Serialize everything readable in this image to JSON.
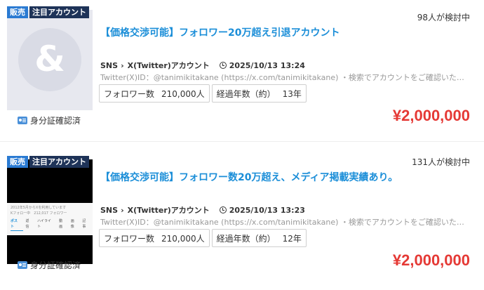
{
  "listings": [
    {
      "badges": {
        "sale": "販売",
        "featured": "注目アカウント"
      },
      "watchers": "98人が検討中",
      "title": "【価格交渉可能】フォロワー20万超え引退アカウント",
      "category": "SNS",
      "subcategory": "X(Twitter)アカウント",
      "posted_at": "2025/10/13 13:24",
      "description": "Twitter(X)ID：@tanimikitakane (https://x.com/tanimikitakane) ・検索でアカウントをご確認いただくこと...",
      "tags": [
        {
          "label": "フォロワー数",
          "value": "210,000人"
        },
        {
          "label": "経過年数（約）",
          "value": "13年"
        }
      ],
      "identity": "身分証確認済",
      "price": "¥2,000,000",
      "thumbnail": "placeholder-avatar-icon"
    },
    {
      "badges": {
        "sale": "販売",
        "featured": "注目アカウント"
      },
      "watchers": "131人が検討中",
      "title": "【価格交渉可能】フォロワー数20万超え、メディア掲載実績あり。",
      "category": "SNS",
      "subcategory": "X(Twitter)アカウント",
      "posted_at": "2025/10/13 13:23",
      "description": "Twitter(X)ID：@tanimikitakane (https://x.com/tanimikitakane) ・検索でアカウントをご確認いただくこと...",
      "tags": [
        {
          "label": "フォロワー数",
          "value": "210,000人"
        },
        {
          "label": "経過年数（約）",
          "value": "12年"
        }
      ],
      "identity": "身分証確認済",
      "price": "¥2,000,000",
      "thumbnail": "account-screenshot",
      "screenshot": {
        "line1": "2012年5月からXを利用しています",
        "line2": "Kフォロー中　212,017 フォロワー",
        "tabs": [
          "ポスト",
          "返信",
          "ハイライト",
          "動画",
          "画像",
          "記事"
        ]
      }
    }
  ],
  "colors": {
    "accent": "#1b8ed8",
    "price": "#e53935",
    "badge_sale": "#2a7ad2",
    "badge_featured": "#1e3358"
  }
}
